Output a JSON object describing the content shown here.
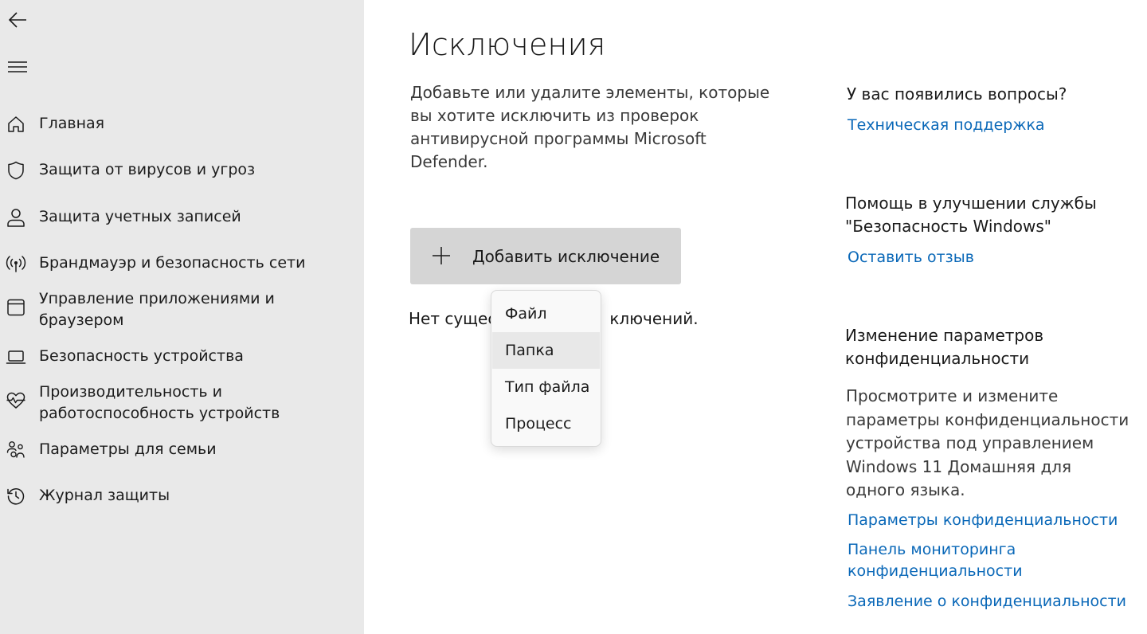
{
  "sidebar": {
    "back_icon": "arrow-left-icon",
    "menu_icon": "hamburger-icon",
    "items": [
      {
        "label": "Главная",
        "icon": "home-icon"
      },
      {
        "label": "Защита от вирусов и угроз",
        "icon": "shield-icon"
      },
      {
        "label": "Защита учетных записей",
        "icon": "person-icon"
      },
      {
        "label": "Брандмауэр и безопасность сети",
        "icon": "wireless-icon"
      },
      {
        "label": "Управление приложениями и браузером",
        "icon": "app-window-icon"
      },
      {
        "label": "Безопасность устройства",
        "icon": "laptop-icon"
      },
      {
        "label": "Производительность и работоспособность устройств",
        "icon": "heart-pulse-icon"
      },
      {
        "label": "Параметры для семьи",
        "icon": "family-icon"
      },
      {
        "label": "Журнал защиты",
        "icon": "history-icon"
      }
    ]
  },
  "main": {
    "title": "Исключения",
    "description": "Добавьте или удалите элементы, которые вы хотите исключить из проверок антивирусной программы Microsoft Defender.",
    "add_button_label": "Добавить исключение",
    "no_items_left": "Нет сущес",
    "no_items_right": "ключений."
  },
  "dropdown": {
    "items": [
      "Файл",
      "Папка",
      "Тип файла",
      "Процесс"
    ],
    "hovered_index": 1
  },
  "side_panel": {
    "questions_heading": "У вас появились вопросы?",
    "support_link": "Техническая поддержка",
    "improve_heading": "Помощь в улучшении службы \"Безопасность Windows\"",
    "feedback_link": "Оставить отзыв",
    "privacy_heading": "Изменение параметров конфиденциальности",
    "privacy_text": "Просмотрите и измените параметры конфиденциальности устройства под управлением Windows 11 Домашняя для одного языка.",
    "privacy_settings_link": "Параметры конфиденциальности",
    "privacy_dashboard_link": "Панель мониторинга конфиденциальности",
    "privacy_statement_link": "Заявление о конфиденциальности"
  },
  "colors": {
    "sidebar_bg": "#e9e9e9",
    "link": "#0a68b8",
    "button_bg": "#d5d5d5"
  }
}
